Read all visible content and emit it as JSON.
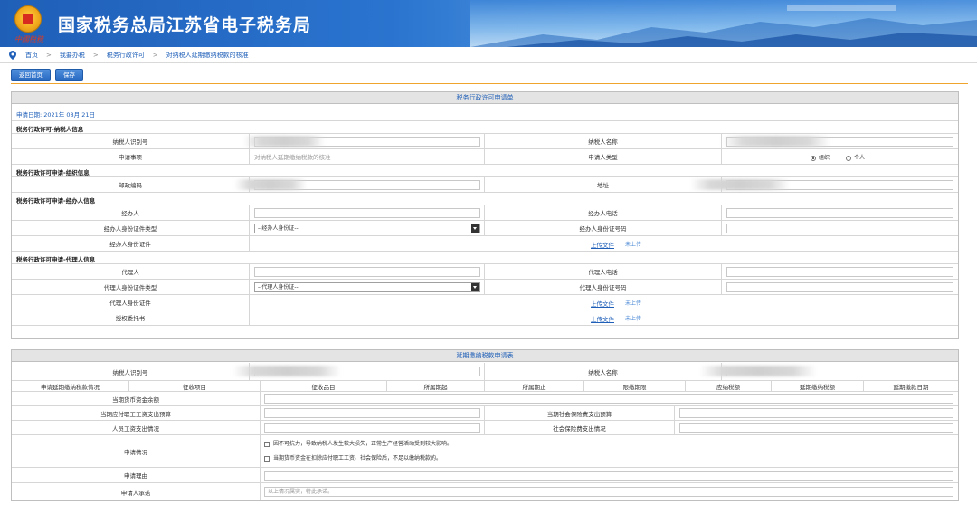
{
  "header": {
    "title": "国家税务总局江苏省电子税务局",
    "slogan": "中國稅務"
  },
  "breadcrumb": [
    "首页",
    "我要办税",
    "税务行政许可",
    "对纳税人延期缴纳税款的核准"
  ],
  "toolbar": {
    "back_label": "返回首页",
    "save_label": "保存"
  },
  "form1": {
    "title": "税务行政许可申请单",
    "apply_date": "申请日期:   2021年   08月   21日",
    "sections": {
      "taxpayer": "税务行政许可-纳税人信息",
      "org": "税务行政许可申请-组织信息",
      "handler": "税务行政许可申请-经办人信息",
      "agent": "税务行政许可申请-代理人信息"
    },
    "labels": {
      "taxpayer_id": "纳税人识别号",
      "taxpayer_name": "纳税人名称",
      "apply_item": "申请事项",
      "applicant_type": "申请人类型",
      "postcode": "邮政编码",
      "address": "地址",
      "handler": "经办人",
      "handler_phone": "经办人电话",
      "handler_id_type": "经办人身份证件类型",
      "handler_id_no": "经办人身份证号码",
      "handler_id_doc": "经办人身份证件",
      "agent": "代理人",
      "agent_phone": "代理人电话",
      "agent_id_type": "代理人身份证件类型",
      "agent_id_no": "代理人身份证号码",
      "agent_id_doc": "代理人身份证件",
      "authorization": "授权委托书"
    },
    "values": {
      "apply_item": "对纳税人延期缴纳税款的核准",
      "handler_id_type_select": "--经办人身份证--",
      "agent_id_type_select": "--代理人身份证--"
    },
    "applicant_options": [
      "组织",
      "个人"
    ],
    "upload_label": "上传文件",
    "not_uploaded": "未上传"
  },
  "form2": {
    "title": "延期缴纳税款申请表",
    "labels": {
      "taxpayer_id": "纳税人识别号",
      "taxpayer_name": "纳税人名称",
      "cash_balance": "当期货币资金余额",
      "wage_budget": "当期应付职工工资支出预算",
      "social_budget": "当期社会保险费支出预算",
      "wage_actual": "人员工资支出情况",
      "social_actual": "社会保险费支出情况",
      "situation": "申请情况",
      "reason": "申请理由",
      "commitment": "申请人承诺"
    },
    "columns": [
      "申请延期缴纳税款情况",
      "征收项目",
      "征收品目",
      "所属期起",
      "所属期止",
      "限缴期限",
      "应纳税额",
      "延期缴纳税额",
      "延期缴款日期"
    ],
    "situation_options": [
      "因不可抗力，导致纳税人发生较大损失，正常生产经营活动受到较大影响。",
      "当期货币资金在扣除应付职工工资、社会保险后，不足以缴纳税款的。"
    ],
    "commitment_placeholder": "以上情况属实，特此承诺。"
  },
  "colors": {
    "brand": "#1f5fb8",
    "accent": "#f0a430"
  }
}
